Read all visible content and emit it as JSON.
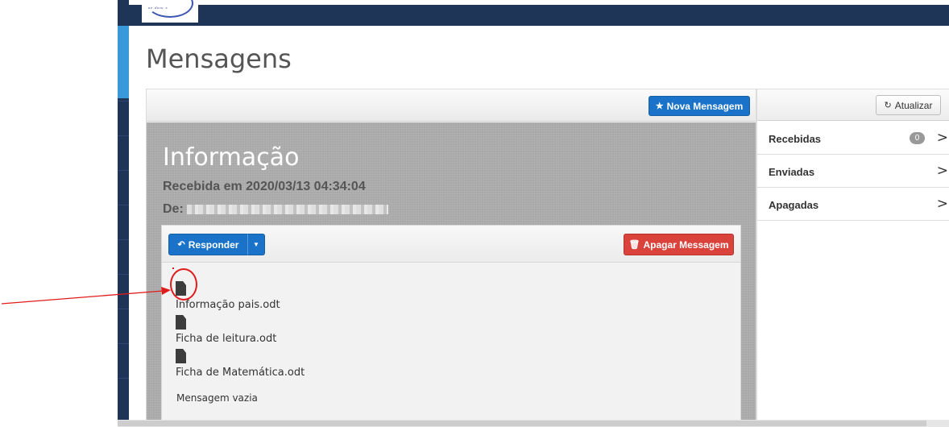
{
  "page": {
    "title": "Mensagens"
  },
  "toolbar": {
    "new_message_label": "Nova Mensagem",
    "refresh_label": "Atualizar"
  },
  "message": {
    "subject": "Informação",
    "received": "Recebida em 2020/03/13 04:34:04",
    "from_label": "De:",
    "reply_label": "Responder",
    "delete_label": "Apagar Messagem",
    "attachments": [
      {
        "name": "Informação pais.odt"
      },
      {
        "name": "Ficha de leitura.odt"
      },
      {
        "name": "Ficha de Matemática.odt"
      }
    ],
    "body_text": "Mensagem vazia"
  },
  "folders": [
    {
      "label": "Recebidas",
      "count": "0"
    },
    {
      "label": "Enviadas"
    },
    {
      "label": "Apagadas"
    }
  ],
  "icons": {
    "new_message": "star-icon",
    "refresh": "refresh-icon",
    "reply": "reply-icon",
    "delete": "trash-icon",
    "attachment": "file-icon",
    "folder_open": "chevron-right-icon"
  },
  "colors": {
    "topbar": "#1f3557",
    "primary": "#1a73c8",
    "danger": "#d9433c",
    "annotation": "#e11b1b"
  }
}
